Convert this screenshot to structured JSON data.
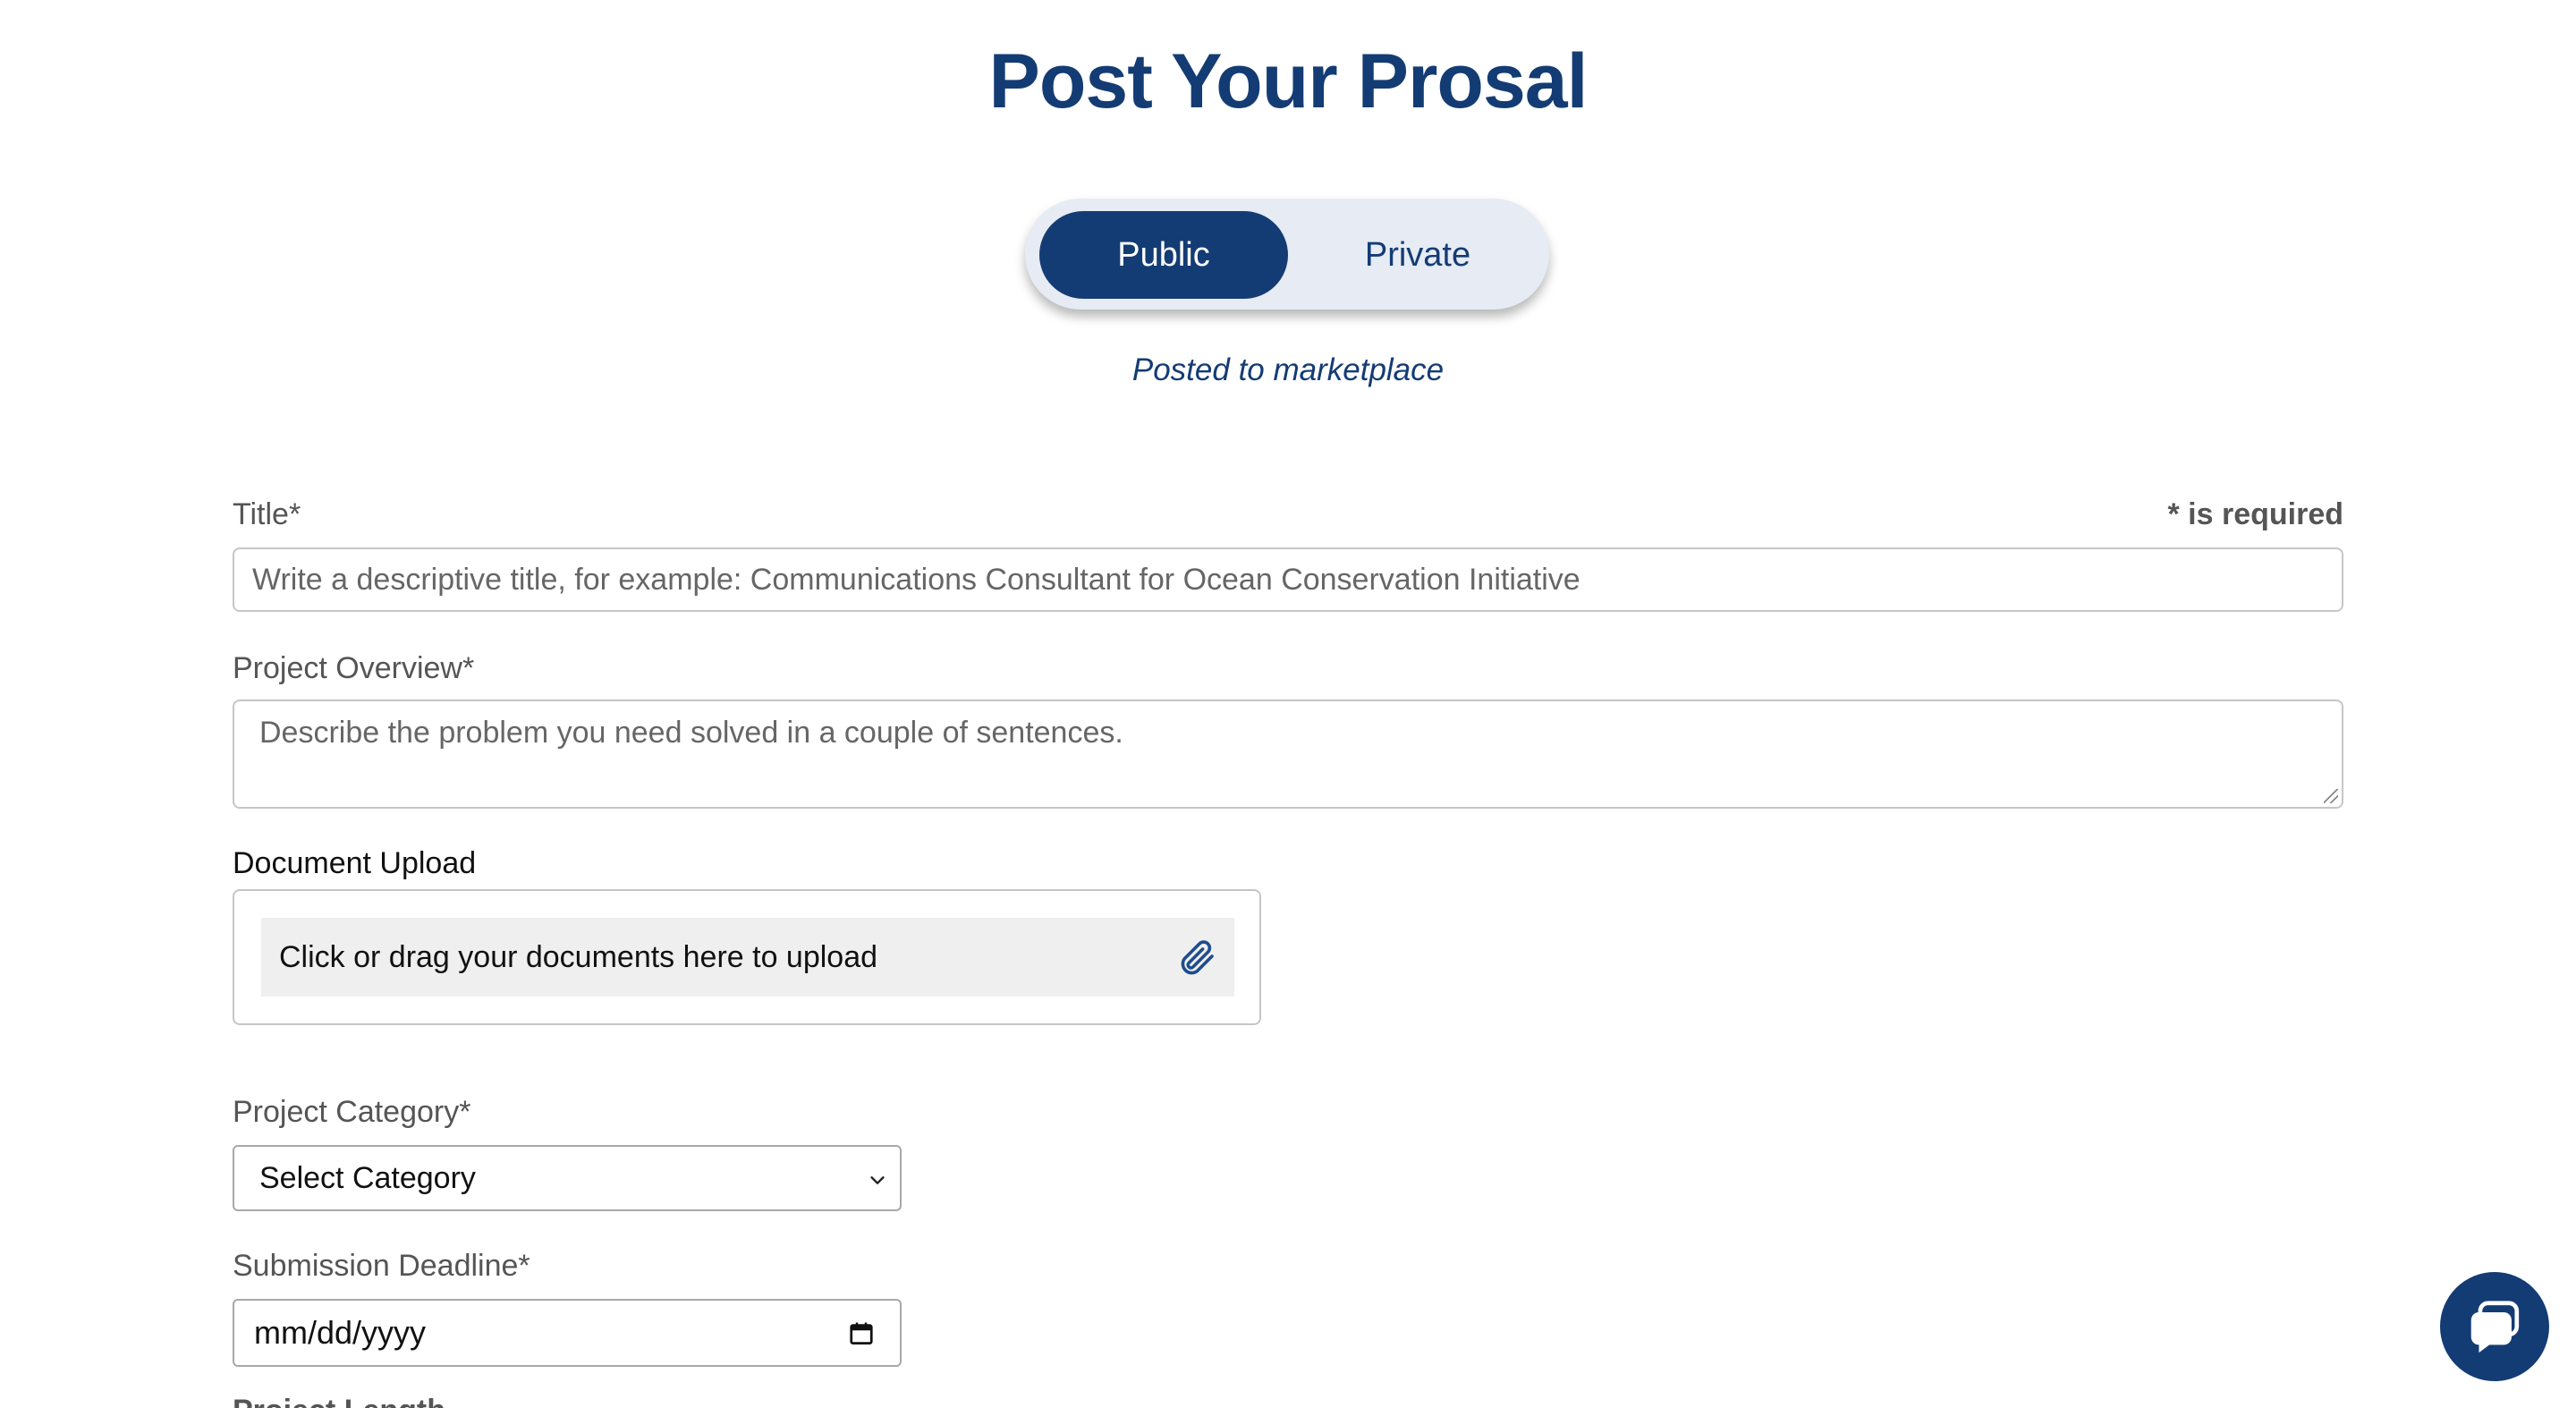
{
  "header": {
    "title": "Post Your Prosal"
  },
  "visibility": {
    "options": [
      "Public",
      "Private"
    ],
    "selected": "Public",
    "caption": "Posted to marketplace"
  },
  "form": {
    "required_note": "* is required",
    "title": {
      "label": "Title*",
      "placeholder": "Write a descriptive title, for example: Communications Consultant for Ocean Conservation Initiative"
    },
    "overview": {
      "label": "Project Overview*",
      "placeholder": "Describe the problem you need solved in a couple of sentences."
    },
    "upload": {
      "label": "Document Upload",
      "prompt": "Click or drag your documents here to upload",
      "icon": "paperclip-icon"
    },
    "category": {
      "label": "Project Category*",
      "selected": "Select Category"
    },
    "deadline": {
      "label": "Submission Deadline*",
      "value": "mm/dd/yyyy",
      "icon": "calendar-icon"
    },
    "length": {
      "label": "Project Length"
    }
  },
  "chat": {
    "icon": "chat-bubble-icon"
  },
  "colors": {
    "brand": "#143c74",
    "toggle_bg": "#e6ebf4",
    "upload_bg": "#f0eff0",
    "label": "#555555"
  }
}
